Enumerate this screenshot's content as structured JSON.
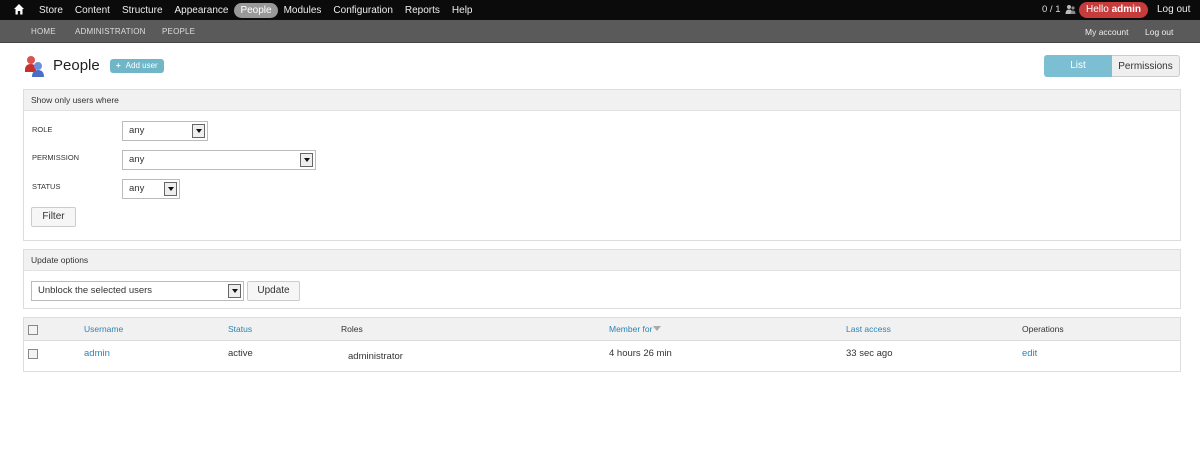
{
  "toolbar": {
    "menu": [
      "Store",
      "Content",
      "Structure",
      "Appearance",
      "People",
      "Modules",
      "Configuration",
      "Reports",
      "Help"
    ],
    "active_menu": "People",
    "counter": "0 / 1",
    "hello_prefix": "Hello",
    "hello_user": "admin",
    "logout": "Log out"
  },
  "shortcuts": {
    "breadcrumb": [
      "HOME",
      "ADMINISTRATION",
      "PEOPLE"
    ],
    "my_account": "My account",
    "logout": "Log out"
  },
  "header": {
    "title": "People",
    "add_user": "Add user",
    "tabs": [
      "List",
      "Permissions"
    ]
  },
  "filter": {
    "legend": "Show only users where",
    "role_label": "ROLE",
    "role_value": "any",
    "permission_label": "PERMISSION",
    "permission_value": "any",
    "status_label": "STATUS",
    "status_value": "any",
    "filter_button": "Filter"
  },
  "update": {
    "legend": "Update options",
    "action_value": "Unblock the selected users",
    "update_button": "Update"
  },
  "table": {
    "headers": {
      "username": "Username",
      "status": "Status",
      "roles": "Roles",
      "member_for": "Member for",
      "last_access": "Last access",
      "operations": "Operations"
    },
    "rows": [
      {
        "username": "admin",
        "status": "active",
        "roles": "administrator",
        "member_for": "4 hours 26 min",
        "last_access": "33 sec ago",
        "operations": "edit"
      }
    ]
  },
  "colors": {
    "toolbar_bg": "#0b0b0b",
    "shortcut_bg": "#5a5a5a",
    "hello_badge": "#c63c3c",
    "accent": "#7dbfd2",
    "link": "#2a84b5"
  }
}
